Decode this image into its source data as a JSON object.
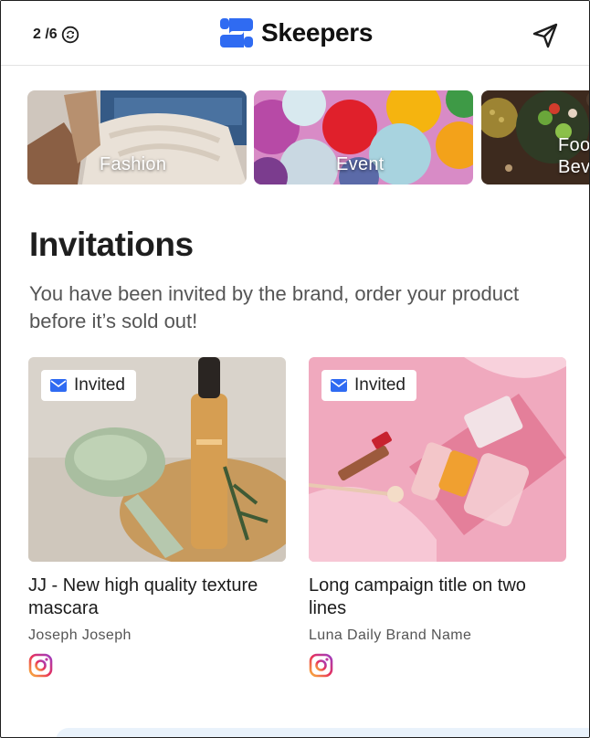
{
  "header": {
    "counter": "2 /6",
    "brand_name": "Skeepers"
  },
  "categories": [
    {
      "label": "Fashion"
    },
    {
      "label": "Event"
    },
    {
      "label": "Food & Beverage",
      "label_line1": "Foo",
      "label_line2": "Beve"
    }
  ],
  "section": {
    "title": "Invitations",
    "subtitle": "You have been invited by the brand, order your product before it’s sold out!"
  },
  "cards": [
    {
      "badge": "Invited",
      "title": "JJ - New high quality texture mascara",
      "brand": "Joseph Joseph"
    },
    {
      "badge": "Invited",
      "title": "Long campaign title on two lines",
      "brand": "Luna Daily Brand Name"
    }
  ],
  "colors": {
    "brand_blue": "#2f6bf2",
    "badge_icon": "#2f6bf2"
  }
}
